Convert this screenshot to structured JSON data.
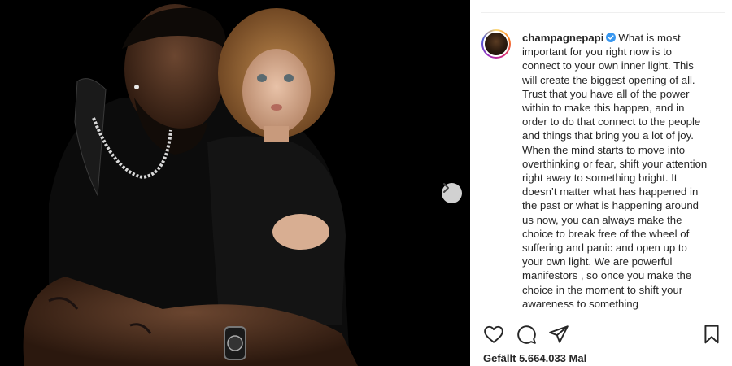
{
  "post": {
    "username": "champagnepapi",
    "verified": true,
    "caption": "What is most important for you right now is to connect to your own inner light. This will create the biggest opening of all. Trust that you have all of the power within to make this happen, and in order to do that connect to the people and things that bring you a lot of joy. When the mind starts to move into overthinking or fear, shift your attention right away to something bright. It doesn’t matter what has happened in the past or what is happening around us now, you can always make the choice to break free of the wheel of suffering and panic and open up to your own light. We are powerful manifestors , so once you make the choice in the moment to shift your awareness to something",
    "likes_text": "Gefällt 5.664.033 Mal"
  },
  "icons": {
    "next": "chevron-right-icon",
    "like": "heart-icon",
    "comment": "comment-icon",
    "share": "paper-plane-icon",
    "save": "bookmark-icon",
    "verified": "verified-badge-icon"
  },
  "colors": {
    "text": "#262626",
    "verified_blue": "#3897f0",
    "photo_bg": "#000000"
  }
}
